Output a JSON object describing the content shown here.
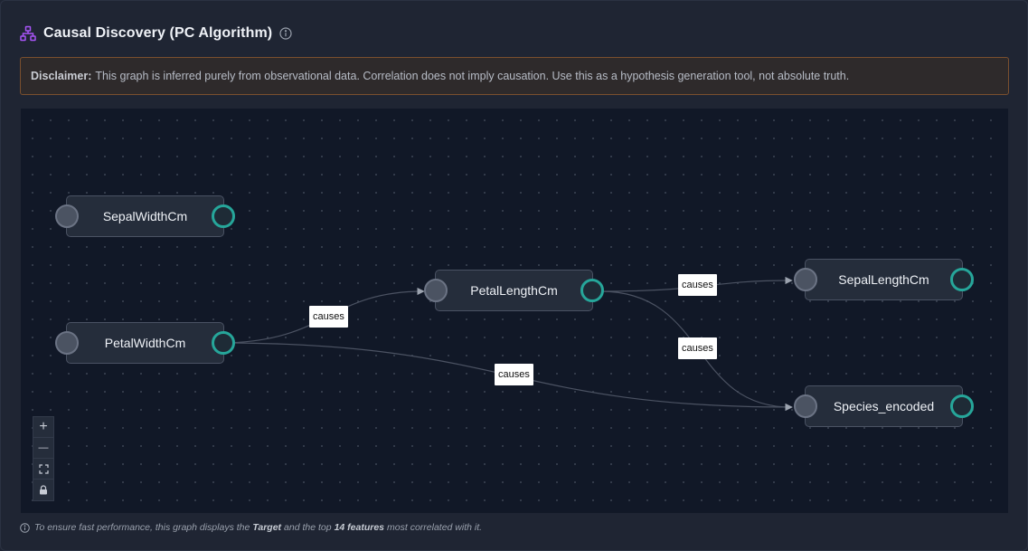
{
  "header": {
    "title": "Causal Discovery (PC Algorithm)",
    "title_icon": "graph-icon",
    "info_icon": "info-icon",
    "accent_color": "#a855f7"
  },
  "disclaimer": {
    "label": "Disclaimer:",
    "text": "This graph is inferred purely from observational data. Correlation does not imply causation. Use this as a hypothesis generation tool, not absolute truth.",
    "border_color": "#7a4f2e"
  },
  "graph": {
    "nodes": [
      {
        "id": "sepalwidth",
        "label": "SepalWidthCm"
      },
      {
        "id": "petalwidth",
        "label": "PetalWidthCm"
      },
      {
        "id": "petallength",
        "label": "PetalLengthCm"
      },
      {
        "id": "sepallength",
        "label": "SepalLengthCm"
      },
      {
        "id": "species",
        "label": "Species_encoded"
      }
    ],
    "edges": [
      {
        "from": "petalwidth",
        "to": "petallength",
        "label": "causes"
      },
      {
        "from": "petalwidth",
        "to": "species",
        "label": "causes"
      },
      {
        "from": "petallength",
        "to": "sepallength",
        "label": "causes"
      },
      {
        "from": "petallength",
        "to": "species",
        "label": "causes"
      }
    ],
    "handle_color": "#26a69a"
  },
  "controls": {
    "zoom_in": "+",
    "zoom_out": "—",
    "fit_view": "⛶",
    "lock": "🔒",
    "icons": [
      "plus-icon",
      "minus-icon",
      "fit-view-icon",
      "lock-icon"
    ]
  },
  "footer": {
    "prefix": "To ensure fast performance, this graph displays the",
    "target": "Target",
    "middle": "and the top",
    "count": "14 features",
    "suffix": "most correlated with it."
  }
}
